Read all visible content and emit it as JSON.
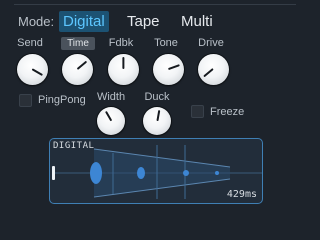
{
  "mode": {
    "label": "Mode:",
    "tabs": [
      "Digital",
      "Tape",
      "Multi"
    ],
    "active": "Digital"
  },
  "knobs": {
    "send": {
      "label": "Send"
    },
    "time": {
      "label": "Time"
    },
    "fdbk": {
      "label": "Fdbk"
    },
    "tone": {
      "label": "Tone"
    },
    "drive": {
      "label": "Drive"
    },
    "width": {
      "label": "Width"
    },
    "duck": {
      "label": "Duck"
    }
  },
  "toggles": {
    "pingpong": {
      "label": "PingPong",
      "checked": false
    },
    "freeze": {
      "label": "Freeze",
      "checked": false
    }
  },
  "display": {
    "title": "DIGITAL",
    "readout": "429ms",
    "accent_color": "#3f7fb4"
  },
  "colors": {
    "background": "#1d232b",
    "active_tab_bg": "#1c5273",
    "active_tab_text": "#5cc6ff"
  }
}
